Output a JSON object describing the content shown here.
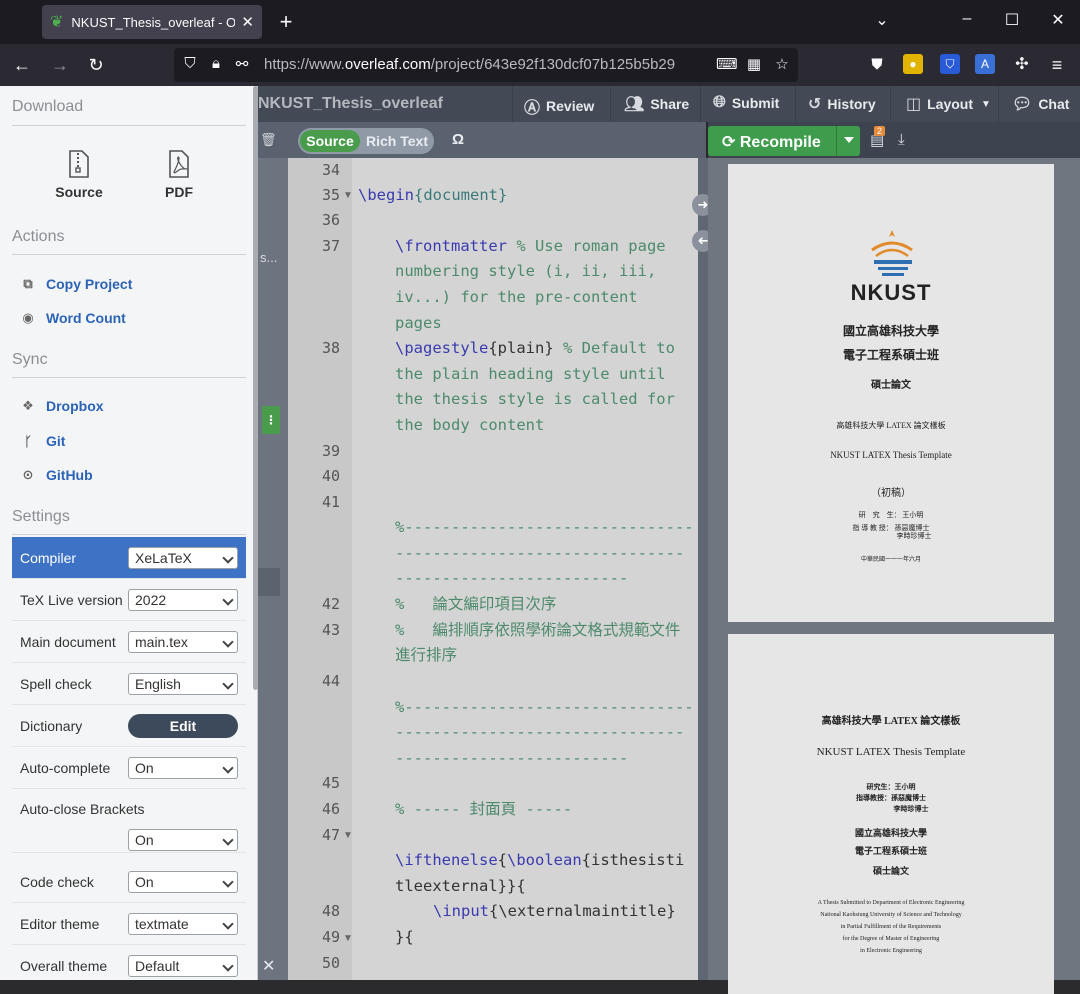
{
  "browser": {
    "tab_title": "NKUST_Thesis_overleaf - Online LaTeX Editor Overleaf",
    "url_prefix": "https://www.",
    "url_domain": "overleaf.com",
    "url_path": "/project/643e92f130dcf07b125b5b29"
  },
  "sidebar": {
    "download_heading": "Download",
    "source_label": "Source",
    "pdf_label": "PDF",
    "actions_heading": "Actions",
    "copy_project": "Copy Project",
    "word_count": "Word Count",
    "sync_heading": "Sync",
    "dropbox": "Dropbox",
    "git": "Git",
    "github": "GitHub",
    "settings_heading": "Settings",
    "settings": [
      {
        "label": "Compiler",
        "value": "XeLaTeX"
      },
      {
        "label": "TeX Live version",
        "value": "2022"
      },
      {
        "label": "Main document",
        "value": "main.tex"
      },
      {
        "label": "Spell check",
        "value": "English"
      },
      {
        "label": "Dictionary",
        "value": "Edit"
      },
      {
        "label": "Auto-complete",
        "value": "On"
      },
      {
        "label": "Auto-close Brackets",
        "value": "On"
      },
      {
        "label": "Code check",
        "value": "On"
      },
      {
        "label": "Editor theme",
        "value": "textmate"
      },
      {
        "label": "Overall theme",
        "value": "Default"
      }
    ]
  },
  "toolbar": {
    "project_title": "NKUST_Thesis_overleaf",
    "review": "Review",
    "share": "Share",
    "submit": "Submit",
    "history": "History",
    "layout": "Layout",
    "chat": "Chat"
  },
  "editor": {
    "source": "Source",
    "rich_text": "Rich Text",
    "omega": "Ω",
    "file_stub": "s...",
    "line_numbers": [
      "34",
      "35",
      "36",
      "37",
      "38",
      "39",
      "40",
      "41",
      "42",
      "43",
      "44",
      "45",
      "46",
      "47",
      "48",
      "49",
      "50"
    ],
    "lines": {
      "l35_cmd": "\\begin",
      "l35_arg": "{document}",
      "l37_cmd": "\\frontmatter",
      "l37_c1": " % Use roman page",
      "l37_c2": "numbering style (i, ii, iii,",
      "l37_c3": "iv...) for the pre-content",
      "l37_c4": "pages",
      "l38_cmd": "\\pagestyle",
      "l38_arg": "{plain}",
      "l38_c1": " % Default to",
      "l38_c2": "the plain heading style until",
      "l38_c3": "the thesis style is called for",
      "l38_c4": "the body content",
      "l41_a": "%-------------------------------",
      "l41_b": "-------------------------------",
      "l41_c": "-------------------------",
      "l42": "%   論文編印項目次序",
      "l43_a": "%   編排順序依照學術論文格式規範文件",
      "l43_b": "進行排序",
      "l44_a": "%-------------------------------",
      "l44_b": "-------------------------------",
      "l44_c": "-------------------------",
      "l46": "% ----- 封面頁 -----",
      "l47_cmd": "\\ifthenelse",
      "l47_b1": "{",
      "l47_cmd2": "\\boolean",
      "l47_arg": "{isthesisti",
      "l47_arg2": "tleexternal",
      "l47_end": "}}{",
      "l48_cmd": "\\input",
      "l48_arg": "{\\externalmaintitle",
      "l48_end": "}",
      "l49": "}{"
    }
  },
  "pdf": {
    "recompile": "Recompile",
    "log_badge": "2",
    "page1": {
      "logo_text": "NKUST",
      "univ": "國立高雄科技大學",
      "dept": "電子工程系碩士班",
      "degree": "碩士論文",
      "title_cn": "高雄科技大學 LATEX 論文樣板",
      "title_en": "NKUST LATEX Thesis Template",
      "draft": "（初稿）",
      "student_label": "研　究　生：",
      "student": "王小明",
      "advisor_label": "指 導 教 授：",
      "advisor1": "孫惡魔博士",
      "advisor2": "李時珍博士",
      "date": "中華民國一一一年六月"
    },
    "page2": {
      "title_cn": "高雄科技大學 LATEX 論文樣板",
      "title_en": "NKUST LATEX Thesis Template",
      "student": "研究生：王小明",
      "advisor": "指導教授：孫惡魔博士",
      "advisor2": "李時珍博士",
      "univ": "國立高雄科技大學",
      "dept": "電子工程系碩士班",
      "degree": "碩士論文",
      "e1": "A Thesis Submitted to Department of Electronic Engineering",
      "e2": "National Kaohsiung University of Science and Technology",
      "e3": "in Partial Fulfillment of the Requirements",
      "e4": "for the Degree of Master of Engineering",
      "e5": "in Electronic Engineering"
    }
  }
}
